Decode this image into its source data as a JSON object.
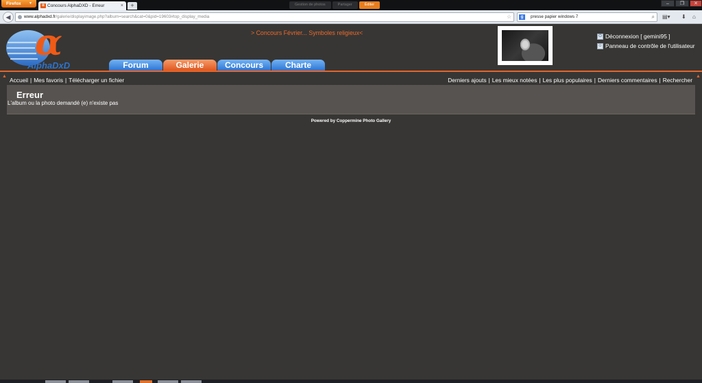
{
  "browser": {
    "menu_button": "Firefox",
    "tab_title": "Concours AlphaDXD - Erreur",
    "url_host": "www.alphadxd.fr",
    "url_path": "/galerie/displayimage.php?album=search&cat=0&pid=19603#top_display_media",
    "search_query": "presse papier windows 7",
    "extension_tabs": [
      "Gestion de photos",
      "Partager",
      "Éditer"
    ]
  },
  "header": {
    "logo_symbol": "α",
    "logo_text": "AlphaDxD",
    "contest_link": "> Concours Février... Symboles religieux<",
    "nav_tabs": [
      {
        "label": "Forum",
        "active": false
      },
      {
        "label": "Galerie",
        "active": true
      },
      {
        "label": "Concours",
        "active": false
      },
      {
        "label": "Charte",
        "active": false
      }
    ],
    "user_links": {
      "logout": "Déconnexion [ gemini95 ]",
      "control_panel": "Panneau de contrôle de l'utilisateur"
    }
  },
  "breadcrumb": {
    "home": "Accueil",
    "favorites": "Mes favoris",
    "upload": "Télécharger un fichier"
  },
  "meta_links": {
    "latest": "Derniers ajouts",
    "top_rated": "Les mieux notées",
    "most_viewed": "Les plus populaires",
    "latest_comments": "Derniers commentaires",
    "search": "Rechercher"
  },
  "error": {
    "title": "Erreur",
    "message": "L'album ou la photo demandé (e) n'existe pas"
  },
  "footer": {
    "text": "Powered by Coppermine Photo Gallery"
  },
  "colors": {
    "page_background": "#373634",
    "accent_orange": "#e7652a",
    "tab_blue": "#2e74d2",
    "box_background": "#575350"
  }
}
